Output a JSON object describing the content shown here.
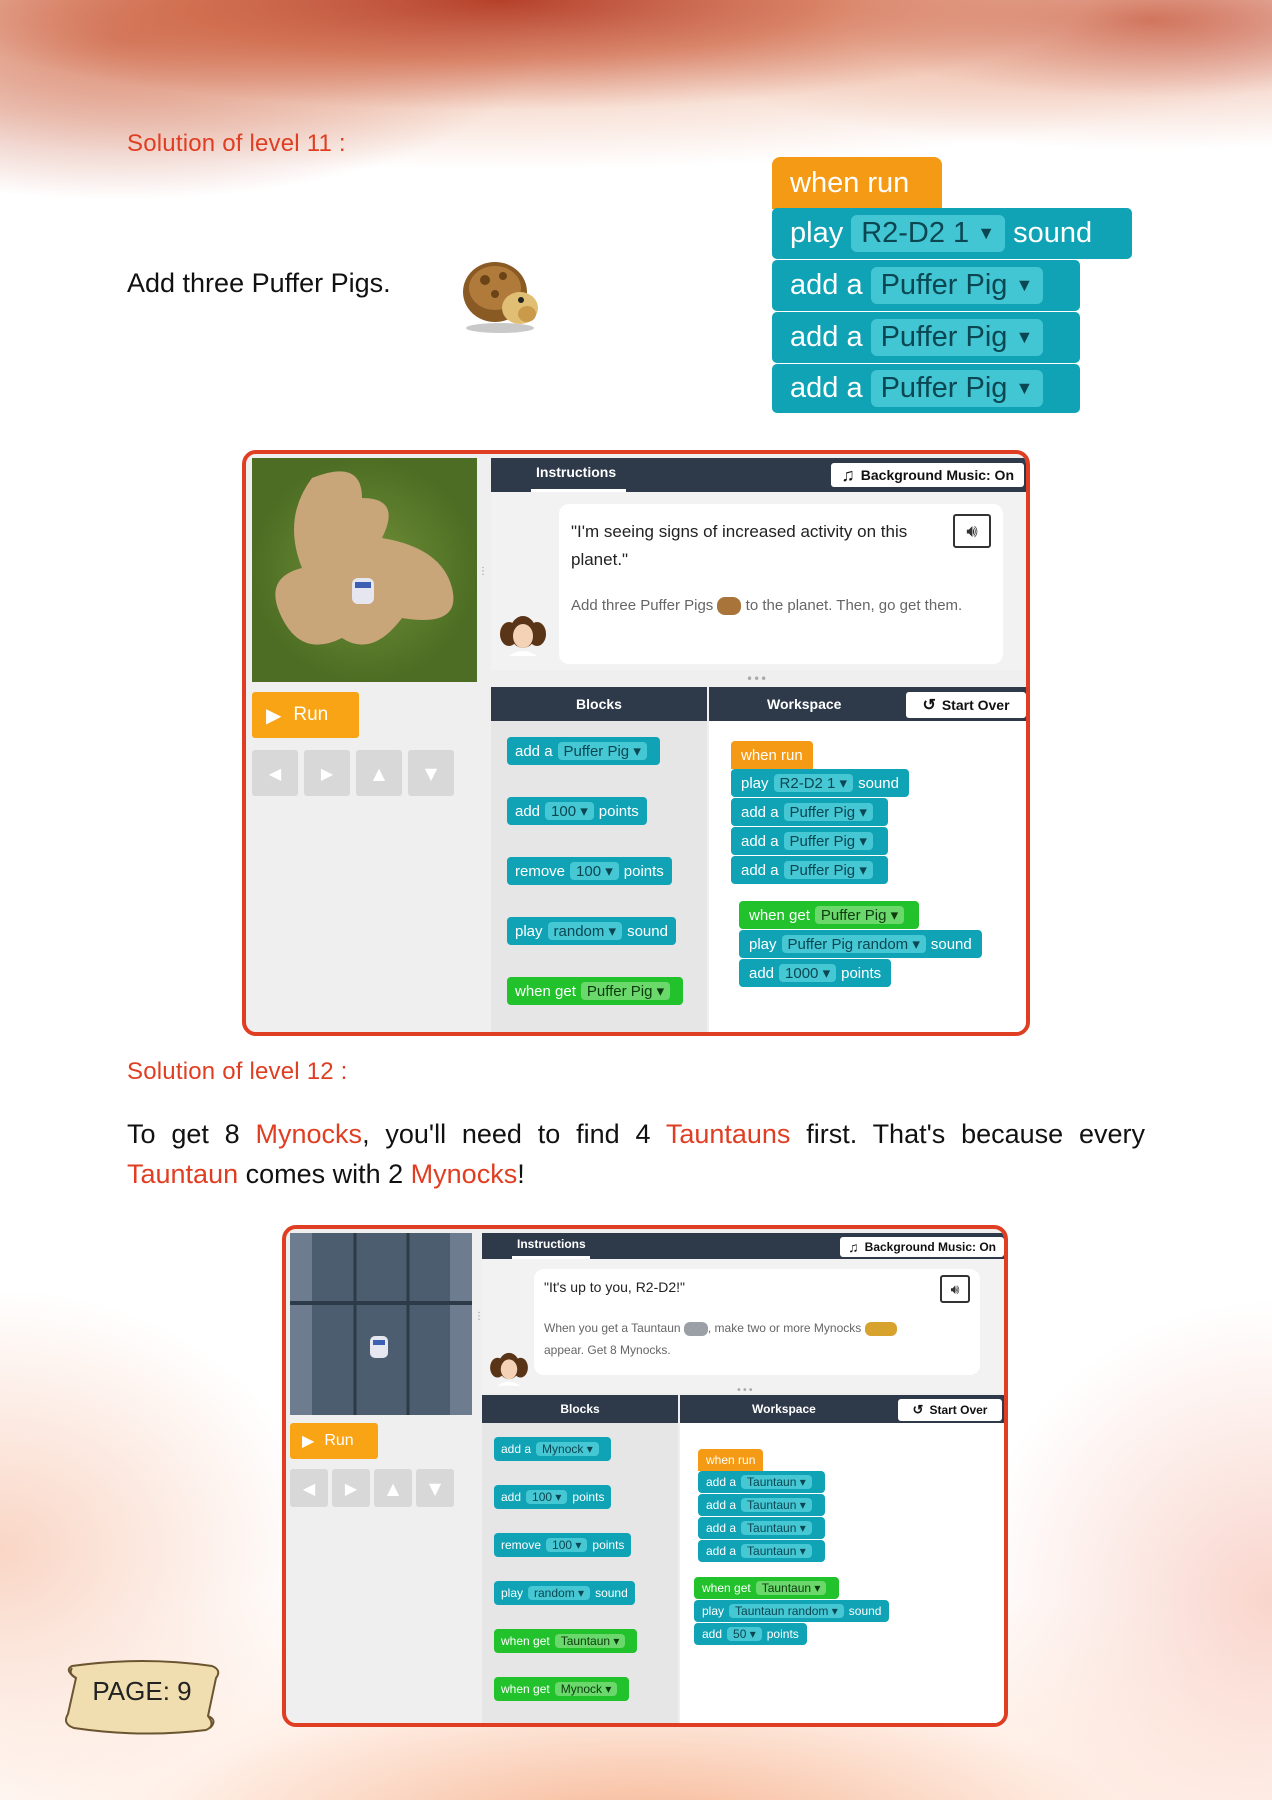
{
  "level11": {
    "heading": "Solution of level 11 :",
    "task": "Add three Puffer Pigs.",
    "code": {
      "when_run": "when run",
      "play_block": {
        "pre": "play",
        "value": "R2-D2 1",
        "post": "sound"
      },
      "add_blocks": [
        {
          "pre": "add a",
          "value": "Puffer Pig"
        },
        {
          "pre": "add a",
          "value": "Puffer Pig"
        },
        {
          "pre": "add a",
          "value": "Puffer Pig"
        }
      ]
    },
    "screenshot": {
      "tab_instructions": "Instructions",
      "background_music": "Background Music: On",
      "quote": "\"I'm seeing signs of increased activity on this planet.\"",
      "instruction_a": "Add three Puffer Pigs",
      "instruction_b": "to the planet. Then, go get them.",
      "run_label": "Run",
      "blocks_header": "Blocks",
      "workspace_header": "Workspace",
      "start_over": "Start Over",
      "palette": [
        {
          "pre": "add a",
          "value": "Puffer Pig",
          "post": "",
          "color": "teal"
        },
        {
          "pre": "add",
          "value": "100",
          "post": "points",
          "color": "teal"
        },
        {
          "pre": "remove",
          "value": "100",
          "post": "points",
          "color": "teal"
        },
        {
          "pre": "play",
          "value": "random",
          "post": "sound",
          "color": "teal"
        },
        {
          "pre": "when get",
          "value": "Puffer Pig",
          "post": "",
          "color": "green"
        }
      ],
      "workspace": {
        "when_run": "when run",
        "play": {
          "pre": "play",
          "value": "R2-D2 1",
          "post": "sound"
        },
        "adds": [
          "Puffer Pig",
          "Puffer Pig",
          "Puffer Pig"
        ],
        "add_pre": "add a",
        "when_get": {
          "pre": "when get",
          "value": "Puffer Pig"
        },
        "play2": {
          "pre": "play",
          "value": "Puffer Pig random",
          "post": "sound"
        },
        "add_points": {
          "pre": "add",
          "value": "1000",
          "post": "points"
        }
      }
    }
  },
  "level12": {
    "heading": "Solution of level 12 :",
    "line1": {
      "a": "To get 8 ",
      "b": "Mynocks",
      "c": ", you'll need to find 4 ",
      "d": "Tauntauns",
      "e": " first. That's because every"
    },
    "line2": {
      "a": "Tauntaun",
      "b": " comes with 2 ",
      "c": "Mynocks",
      "d": "!"
    },
    "screenshot": {
      "tab_instructions": "Instructions",
      "background_music": "Background Music: On",
      "quote": "\"It's up to you, R2-D2!\"",
      "instruction_a": "When you get a Tauntaun",
      "instruction_b": ", make two or more Mynocks",
      "instruction_c": "appear. Get 8 Mynocks.",
      "run_label": "Run",
      "blocks_header": "Blocks",
      "workspace_header": "Workspace",
      "start_over": "Start Over",
      "palette": [
        {
          "pre": "add a",
          "value": "Mynock",
          "post": "",
          "color": "teal"
        },
        {
          "pre": "add",
          "value": "100",
          "post": "points",
          "color": "teal"
        },
        {
          "pre": "remove",
          "value": "100",
          "post": "points",
          "color": "teal"
        },
        {
          "pre": "play",
          "value": "random",
          "post": "sound",
          "color": "teal"
        },
        {
          "pre": "when get",
          "value": "Tauntaun",
          "post": "",
          "color": "green"
        },
        {
          "pre": "when get",
          "value": "Mynock",
          "post": "",
          "color": "green"
        }
      ],
      "workspace": {
        "when_run": "when run",
        "add_pre": "add a",
        "adds": [
          "Tauntaun",
          "Tauntaun",
          "Tauntaun",
          "Tauntaun"
        ],
        "when_get": {
          "pre": "when get",
          "value": "Tauntaun"
        },
        "play2": {
          "pre": "play",
          "value": "Tauntaun random",
          "post": "sound"
        },
        "add_points": {
          "pre": "add",
          "value": "50",
          "post": "points"
        }
      }
    }
  },
  "footer": {
    "page_label": "PAGE: 9"
  },
  "colors": {
    "accent": "#e03e22",
    "block_teal": "#0fa3b5",
    "block_orange": "#f59a14",
    "block_green": "#22c22c",
    "run_orange": "#f9a415"
  }
}
